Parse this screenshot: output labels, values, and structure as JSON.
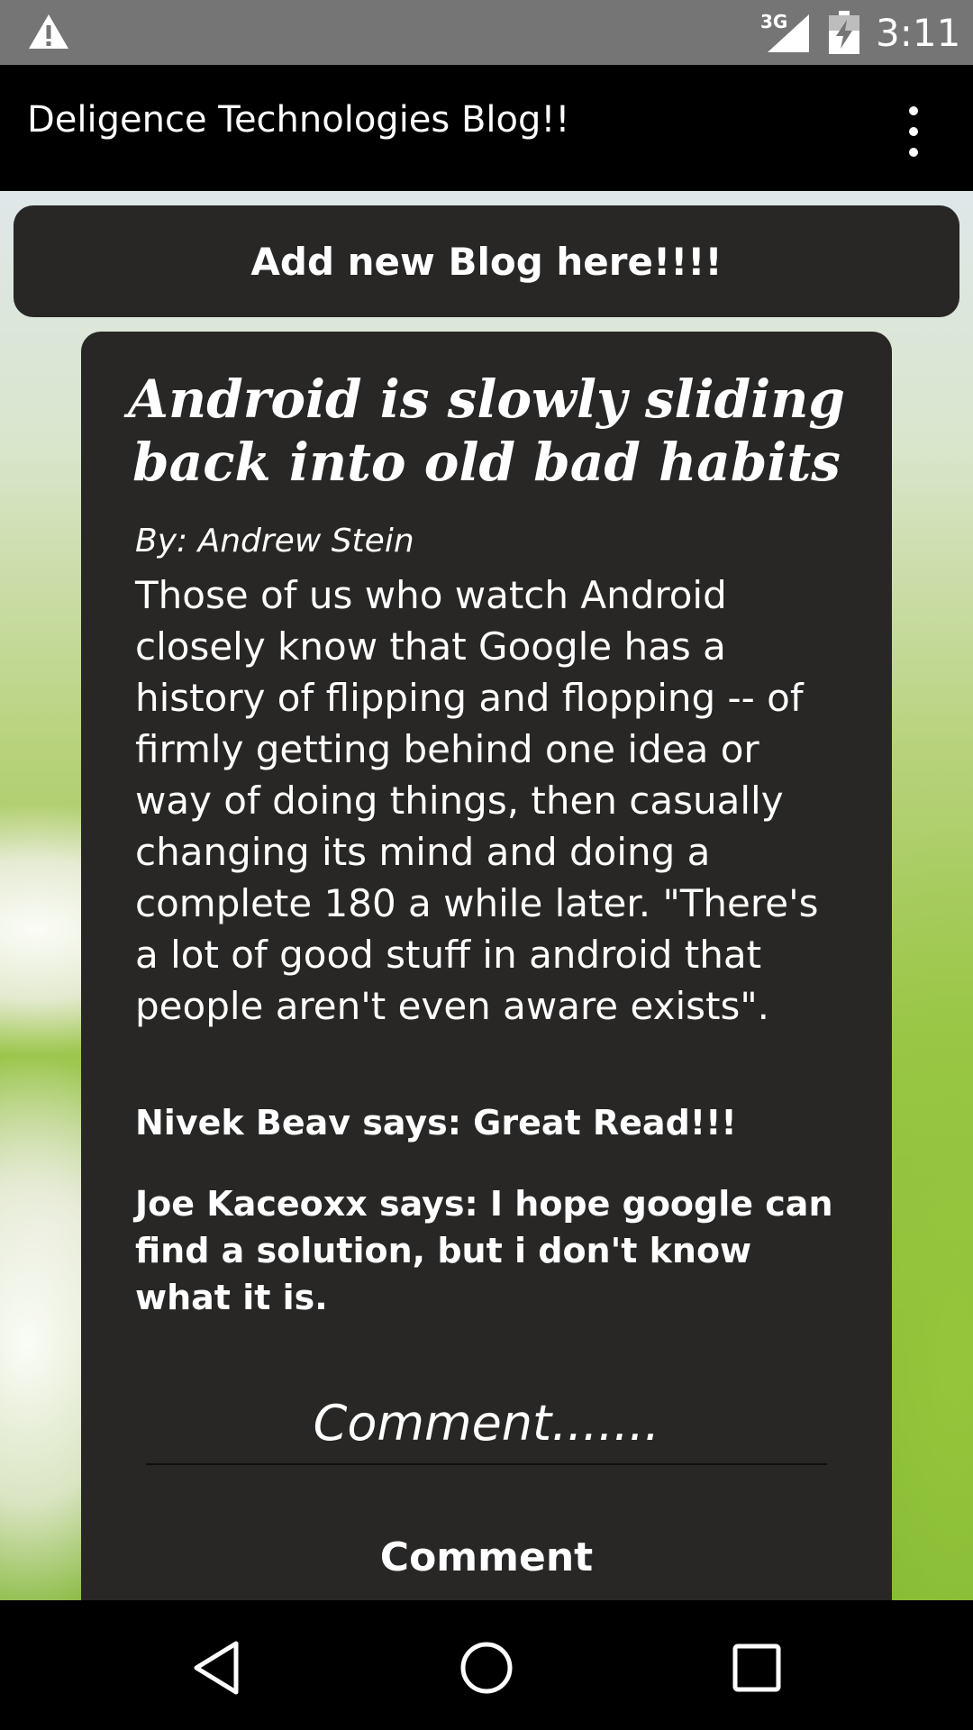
{
  "status_bar": {
    "network": "3G",
    "time": "3:11",
    "icons": [
      "warning-icon",
      "signal-icon",
      "battery-charging-icon"
    ]
  },
  "app_bar": {
    "title": "Deligence Technologies Blog!!",
    "menu_icon": "overflow-menu-icon"
  },
  "add_blog_button": {
    "label": "Add new Blog here!!!!"
  },
  "blog": {
    "title_line_1": "Android is slowly sliding",
    "title_line_2": "back into old bad habits",
    "author": "By: Andrew Stein",
    "body": "Those of us who watch Android closely know that Google has a history of flipping and flopping -- of firmly getting behind one idea or way of doing things, then casually changing its mind and doing a complete 180 a while later. \"There's a lot of good stuff in android that people aren't even aware exists\".",
    "comments": [
      {
        "text": "Nivek Beav says: Great Read!!!"
      },
      {
        "text": "Joe Kaceoxx says: I hope google can find a solution, but i don't know what it is."
      }
    ],
    "comment_input": {
      "placeholder": "Comment.......",
      "value": ""
    },
    "comment_button_label": "Comment"
  },
  "nav_bar": {
    "icons": [
      "back-icon",
      "home-icon",
      "recents-icon"
    ]
  },
  "colors": {
    "status_bar": "#757575",
    "app_bar": "#000000",
    "card": "#282725",
    "nav_bar": "#000000"
  }
}
